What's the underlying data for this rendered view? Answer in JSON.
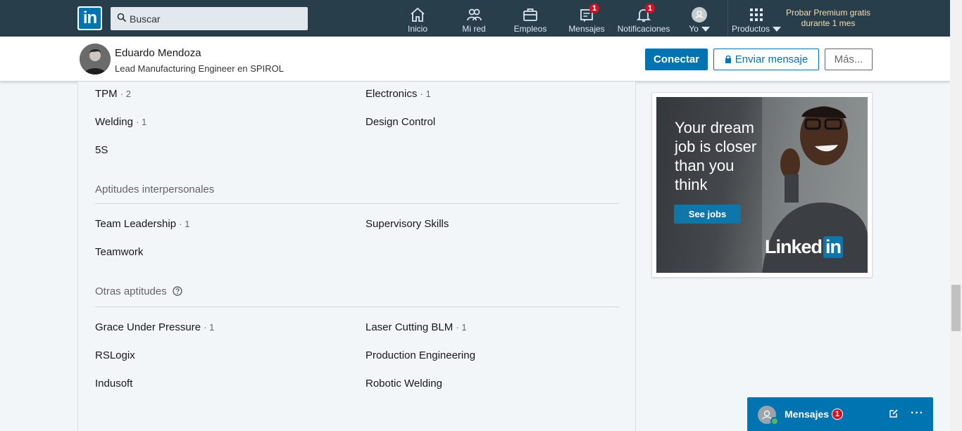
{
  "nav": {
    "logo_text": "in",
    "search_placeholder": "Buscar",
    "items": [
      {
        "label": "Inicio"
      },
      {
        "label": "Mi red"
      },
      {
        "label": "Empleos"
      },
      {
        "label": "Mensajes",
        "badge": "1"
      },
      {
        "label": "Notificaciones",
        "badge": "1"
      },
      {
        "label": "Yo"
      },
      {
        "label": "Productos"
      }
    ],
    "premium_line1": "Probar Premium gratis",
    "premium_line2": "durante 1 mes"
  },
  "profile": {
    "name": "Eduardo Mendoza",
    "headline": "Lead Manufacturing Engineer en SPIROL",
    "connect_label": "Conectar",
    "message_label": "Enviar mensaje",
    "more_label": "Más..."
  },
  "skills": {
    "top_list": [
      {
        "name": "TPM",
        "count": "· 2"
      },
      {
        "name": "Electronics",
        "count": "· 1"
      },
      {
        "name": "Welding",
        "count": "· 1"
      },
      {
        "name": "Design Control",
        "count": ""
      },
      {
        "name": "5S",
        "count": ""
      }
    ],
    "interpersonal": {
      "title": "Aptitudes interpersonales",
      "items": [
        {
          "name": "Team Leadership",
          "count": "· 1"
        },
        {
          "name": "Supervisory Skills",
          "count": ""
        },
        {
          "name": "Teamwork",
          "count": ""
        }
      ]
    },
    "other": {
      "title": "Otras aptitudes",
      "items": [
        {
          "name": "Grace Under Pressure",
          "count": "· 1"
        },
        {
          "name": "Laser Cutting BLM",
          "count": "· 1"
        },
        {
          "name": "RSLogix",
          "count": ""
        },
        {
          "name": "Production Engineering",
          "count": ""
        },
        {
          "name": "Indusoft",
          "count": ""
        },
        {
          "name": "Robotic Welding",
          "count": ""
        }
      ]
    }
  },
  "ad": {
    "headline": "Your dream job is closer than you think",
    "button": "See jobs",
    "logo_text": "Linked",
    "logo_in": "in"
  },
  "messaging": {
    "label": "Mensajes",
    "badge": "1",
    "more": "···"
  },
  "colors": {
    "nav_bg": "#283e4a",
    "brand_blue": "#0073b1",
    "badge_red": "#d11124",
    "page_bg": "#f3f6f8"
  }
}
